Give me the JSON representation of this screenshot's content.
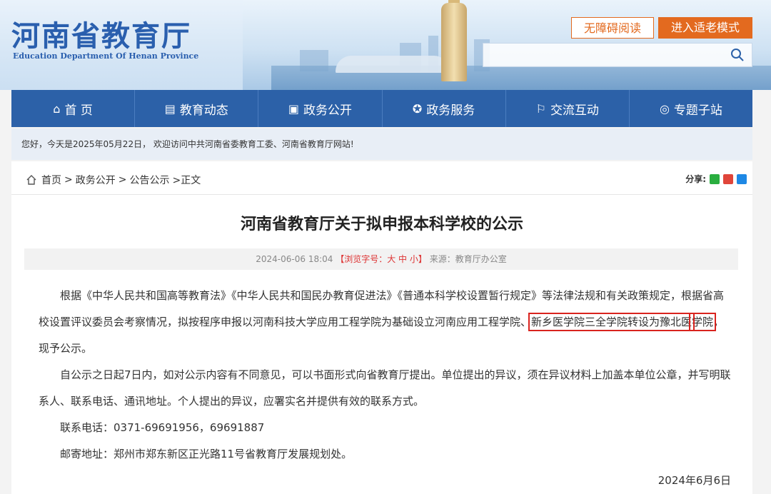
{
  "header": {
    "logo_cn": "河南省教育厅",
    "logo_en": "Education Department Of Henan Province",
    "accessible_btn": "无障碍阅读",
    "elder_btn": "进入适老模式"
  },
  "nav": [
    {
      "label": "首 页",
      "icon": "home-icon",
      "glyph": "⌂"
    },
    {
      "label": "教育动态",
      "icon": "newspaper-icon",
      "glyph": "▤"
    },
    {
      "label": "政务公开",
      "icon": "document-icon",
      "glyph": "▣"
    },
    {
      "label": "政务服务",
      "icon": "service-icon",
      "glyph": "✪"
    },
    {
      "label": "交流互动",
      "icon": "chat-icon",
      "glyph": "⚐"
    },
    {
      "label": "专题子站",
      "icon": "target-icon",
      "glyph": "◎"
    }
  ],
  "welcome": "您好，今天是2025年05月22日， 欢迎访问中共河南省委教育工委、河南省教育厅网站!",
  "breadcrumb": {
    "home": "首页",
    "sep": ">",
    "l1": "政务公开",
    "l2": "公告公示",
    "current": ">正文"
  },
  "share": {
    "label": "分享:"
  },
  "article": {
    "title": "河南省教育厅关于拟申报本科学校的公示",
    "date": "2024-06-06 18:04",
    "font_ctl": "【浏览字号：大 中 小】",
    "source": "来源：教育厅办公室",
    "p1_pre": "根据《中华人民共和国高等教育法》《中华人民共和国民办教育促进法》《普通本科学校设置暂行规定》等法律法规和有关政策规定，根据省高校设置评议委员会考察情况，拟按程序申报以河南科技大学应用工程学院为基础设立河南应用工程学院、",
    "p1_hl1": "新乡医学院三全学院转设为豫北医",
    "p1_hl2": "学院",
    "p1_post": "，现予公示。",
    "p2": "自公示之日起7日内，如对公示内容有不同意见，可以书面形式向省教育厅提出。单位提出的异议，须在异议材料上加盖本单位公章，并写明联系人、联系电话、通讯地址。个人提出的异议，应署实名并提供有效的联系方式。",
    "p3": "联系电话：0371-69691956，69691887",
    "p4": "邮寄地址：郑州市郑东新区正光路11号省教育厅发展规划处。",
    "sign_date": "2024年6月6日"
  },
  "colors": {
    "nav": "#2c61a8",
    "accent": "#e36a1f",
    "highlight": "#d9231e"
  }
}
